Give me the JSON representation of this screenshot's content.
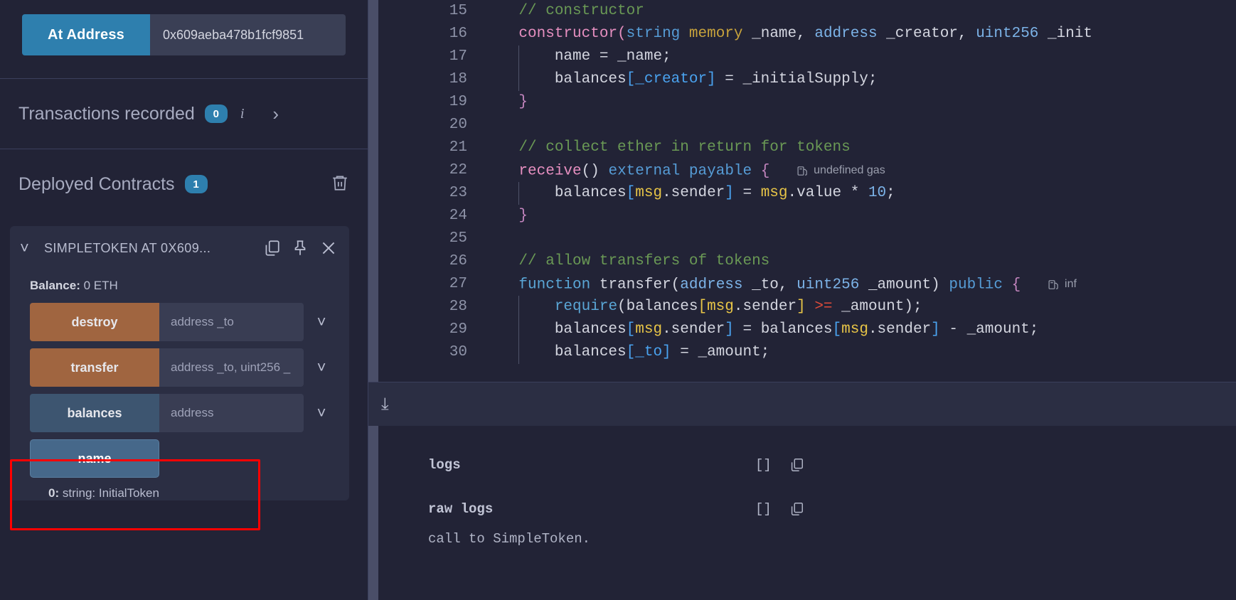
{
  "left_panel": {
    "at_address": {
      "button_label": "At Address",
      "input_value": "0x609aeba478b1fcf9851"
    },
    "transactions": {
      "title": "Transactions recorded",
      "count": "0",
      "info_icon": "info-icon",
      "expand_icon": "chevron-right-icon"
    },
    "deployed": {
      "title": "Deployed Contracts",
      "count": "1",
      "trash_icon": "trash-icon"
    },
    "contract": {
      "name": "SIMPLETOKEN AT 0X609...",
      "collapse_icon": "chevron-down-icon",
      "copy_icon": "copy-icon",
      "pin_icon": "pin-icon",
      "close_icon": "close-icon",
      "balance_label": "Balance:",
      "balance_value": "0 ETH",
      "functions": [
        {
          "label": "destroy",
          "placeholder": "address _to",
          "kind": "orange",
          "caret": "chevron-down-icon"
        },
        {
          "label": "transfer",
          "placeholder": "address _to, uint256 _",
          "kind": "orange",
          "caret": "chevron-down-icon"
        },
        {
          "label": "balances",
          "placeholder": "address",
          "kind": "blue",
          "caret": "chevron-down-icon"
        }
      ],
      "name_call": {
        "label": "name",
        "result_index": "0:",
        "result_text": "string: InitialToken"
      }
    }
  },
  "editor": {
    "lines": [
      {
        "num": "15",
        "tokens": [
          {
            "t": "    ",
            "c": "tok-white"
          },
          {
            "t": "// constructor",
            "c": "tok-comment"
          }
        ]
      },
      {
        "num": "16",
        "tokens": [
          {
            "t": "    ",
            "c": "tok-white"
          },
          {
            "t": "constructor",
            "c": "tok-kw"
          },
          {
            "t": "(",
            "c": "tok-kw"
          },
          {
            "t": "string",
            "c": "tok-type"
          },
          {
            "t": " ",
            "c": "tok-white"
          },
          {
            "t": "memory",
            "c": "tok-mem"
          },
          {
            "t": " _name, ",
            "c": "tok-white"
          },
          {
            "t": "address",
            "c": "tok-type2"
          },
          {
            "t": " _creator, ",
            "c": "tok-white"
          },
          {
            "t": "uint256",
            "c": "tok-type2"
          },
          {
            "t": " _init",
            "c": "tok-white"
          }
        ]
      },
      {
        "num": "17",
        "tokens": [
          {
            "t": "        name = _name;",
            "c": "tok-white"
          }
        ]
      },
      {
        "num": "18",
        "tokens": [
          {
            "t": "        balances",
            "c": "tok-white"
          },
          {
            "t": "[_creator]",
            "c": "tok-idx"
          },
          {
            "t": " = _initialSupply;",
            "c": "tok-white"
          }
        ]
      },
      {
        "num": "19",
        "tokens": [
          {
            "t": "    ",
            "c": "tok-white"
          },
          {
            "t": "}",
            "c": "tok-kw2"
          }
        ]
      },
      {
        "num": "20",
        "tokens": []
      },
      {
        "num": "21",
        "tokens": [
          {
            "t": "    ",
            "c": "tok-white"
          },
          {
            "t": "// collect ether in return for tokens",
            "c": "tok-comment"
          }
        ]
      },
      {
        "num": "22",
        "tokens": [
          {
            "t": "    ",
            "c": "tok-white"
          },
          {
            "t": "receive",
            "c": "tok-kw"
          },
          {
            "t": "()",
            "c": "tok-white"
          },
          {
            "t": " ",
            "c": "tok-white"
          },
          {
            "t": "external",
            "c": "tok-type"
          },
          {
            "t": " ",
            "c": "tok-white"
          },
          {
            "t": "payable",
            "c": "tok-type"
          },
          {
            "t": " ",
            "c": "tok-white"
          },
          {
            "t": "{",
            "c": "tok-kw2"
          }
        ],
        "gas": "undefined gas"
      },
      {
        "num": "23",
        "tokens": [
          {
            "t": "        balances",
            "c": "tok-white"
          },
          {
            "t": "[",
            "c": "tok-idx"
          },
          {
            "t": "msg",
            "c": "tok-msg"
          },
          {
            "t": ".sender",
            "c": "tok-white"
          },
          {
            "t": "]",
            "c": "tok-idx"
          },
          {
            "t": " = ",
            "c": "tok-white"
          },
          {
            "t": "msg",
            "c": "tok-msg"
          },
          {
            "t": ".value * ",
            "c": "tok-white"
          },
          {
            "t": "10",
            "c": "tok-type2"
          },
          {
            "t": ";",
            "c": "tok-white"
          }
        ]
      },
      {
        "num": "24",
        "tokens": [
          {
            "t": "    ",
            "c": "tok-white"
          },
          {
            "t": "}",
            "c": "tok-kw2"
          }
        ]
      },
      {
        "num": "25",
        "tokens": []
      },
      {
        "num": "26",
        "tokens": [
          {
            "t": "    ",
            "c": "tok-white"
          },
          {
            "t": "// allow transfers of tokens",
            "c": "tok-comment"
          }
        ]
      },
      {
        "num": "27",
        "tokens": [
          {
            "t": "    ",
            "c": "tok-white"
          },
          {
            "t": "function",
            "c": "tok-fn"
          },
          {
            "t": " transfer(",
            "c": "tok-white"
          },
          {
            "t": "address",
            "c": "tok-type2"
          },
          {
            "t": " _to, ",
            "c": "tok-white"
          },
          {
            "t": "uint256",
            "c": "tok-type2"
          },
          {
            "t": " _amount) ",
            "c": "tok-white"
          },
          {
            "t": "public",
            "c": "tok-type"
          },
          {
            "t": " ",
            "c": "tok-white"
          },
          {
            "t": "{",
            "c": "tok-kw2"
          }
        ],
        "gas": "inf"
      },
      {
        "num": "28",
        "tokens": [
          {
            "t": "        ",
            "c": "tok-white"
          },
          {
            "t": "require",
            "c": "tok-fn"
          },
          {
            "t": "(balances",
            "c": "tok-white"
          },
          {
            "t": "[",
            "c": "tok-msg"
          },
          {
            "t": "msg",
            "c": "tok-msg"
          },
          {
            "t": ".sender",
            "c": "tok-white"
          },
          {
            "t": "]",
            "c": "tok-msg"
          },
          {
            "t": " ",
            "c": "tok-white"
          },
          {
            "t": ">=",
            "c": "tok-op"
          },
          {
            "t": " _amount);",
            "c": "tok-white"
          }
        ]
      },
      {
        "num": "29",
        "tokens": [
          {
            "t": "        balances",
            "c": "tok-white"
          },
          {
            "t": "[",
            "c": "tok-idx"
          },
          {
            "t": "msg",
            "c": "tok-msg"
          },
          {
            "t": ".sender",
            "c": "tok-white"
          },
          {
            "t": "]",
            "c": "tok-idx"
          },
          {
            "t": " = balances",
            "c": "tok-white"
          },
          {
            "t": "[",
            "c": "tok-idx"
          },
          {
            "t": "msg",
            "c": "tok-msg"
          },
          {
            "t": ".sender",
            "c": "tok-white"
          },
          {
            "t": "]",
            "c": "tok-idx"
          },
          {
            "t": " - _amount;",
            "c": "tok-white"
          }
        ]
      },
      {
        "num": "30",
        "tokens": [
          {
            "t": "        balances",
            "c": "tok-white"
          },
          {
            "t": "[_to]",
            "c": "tok-idx"
          },
          {
            "t": " = _amount;",
            "c": "tok-white"
          }
        ]
      }
    ]
  },
  "terminal": {
    "toggle_icon": "chevron-double-down-icon",
    "rows": [
      {
        "key": "logs",
        "value": "[]",
        "copy_icon": "copy-icon"
      },
      {
        "key": "raw logs",
        "value": "[]",
        "copy_icon": "copy-icon"
      }
    ],
    "partial_text": "call to SimpleToken."
  },
  "colors": {
    "accent": "#2e7fae",
    "bg": "#222336",
    "panel": "#2b2e43",
    "orange_btn": "#a06540",
    "blue_btn": "#3d5570",
    "highlight": "#ff0000"
  }
}
